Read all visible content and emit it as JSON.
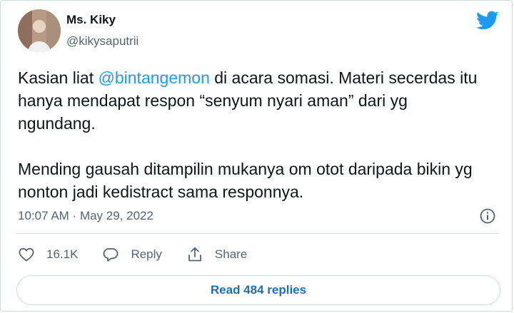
{
  "author": {
    "name": "Ms. Kiky",
    "handle": "@kikysaputrii"
  },
  "tweet": {
    "line1_pre": "Kasian liat ",
    "mention": "@bintangemon",
    "line1_post": " di acara somasi. Materi secerdas itu hanya mendapat respon “senyum nyari aman” dari yg ngundang.",
    "paragraph2": "Mending gausah ditampilin mukanya om otot daripada bikin yg nonton jadi kedistract sama responnya."
  },
  "meta": {
    "time": "10:07 AM",
    "separator": " · ",
    "date": "May 29, 2022"
  },
  "actions": {
    "like_count": "16.1K",
    "reply_label": "Reply",
    "share_label": "Share"
  },
  "read_replies_label": "Read 484 replies",
  "icons": {
    "logo": "twitter-bird-icon",
    "info": "info-icon",
    "like": "heart-icon",
    "reply": "comment-icon",
    "share": "share-icon"
  },
  "colors": {
    "accent": "#1d9bf0",
    "text": "#0f1419",
    "muted": "#536471",
    "border": "#cfd9de"
  }
}
